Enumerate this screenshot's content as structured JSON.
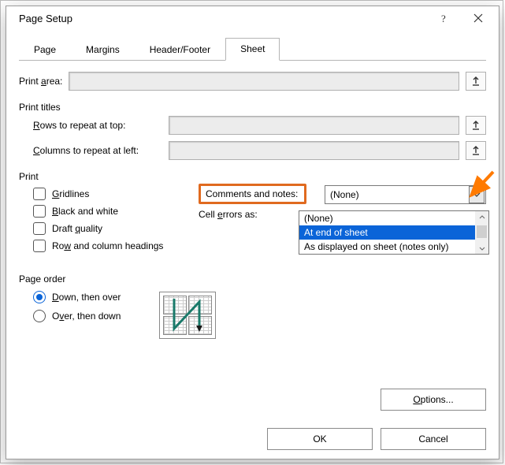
{
  "title": "Page Setup",
  "tabs": {
    "page": "Page",
    "margins": "Margins",
    "header_footer": "Header/Footer",
    "sheet": "Sheet"
  },
  "print_area_label_pre": "Print ",
  "print_area_label_u": "a",
  "print_area_label_post": "rea:",
  "print_titles_hdr": "Print titles",
  "rows_u": "R",
  "rows_label": "ows to repeat at top:",
  "cols_u": "C",
  "cols_label": "olumns to repeat at left:",
  "print_hdr": "Print",
  "chk_gridlines_u": "G",
  "chk_gridlines_label": "ridlines",
  "chk_bw_u": "B",
  "chk_bw_label": "lack and white",
  "chk_draft_u": "q",
  "chk_draft_label_pre": "Draft ",
  "chk_draft_label_post": "uality",
  "chk_rowcol_u": "w",
  "chk_rowcol_label_pre": "Ro",
  "chk_rowcol_label_post": " and column headings",
  "comments_label": "Comments and notes:",
  "cell_errors_label_pre": "Cell ",
  "cell_errors_u": "e",
  "cell_errors_label_post": "rrors as:",
  "combo_value": "(None)",
  "combo_options": {
    "none": "(None)",
    "end": "At end of sheet",
    "displayed": "As displayed on sheet (notes only)"
  },
  "page_order_hdr": "Page order",
  "radio_down_u": "D",
  "radio_down_label": "own, then over",
  "radio_over_u": "v",
  "radio_over_label_pre": "O",
  "radio_over_label_post": "er, then down",
  "options_btn_u": "O",
  "options_btn_label": "ptions...",
  "ok_btn": "OK",
  "cancel_btn": "Cancel"
}
